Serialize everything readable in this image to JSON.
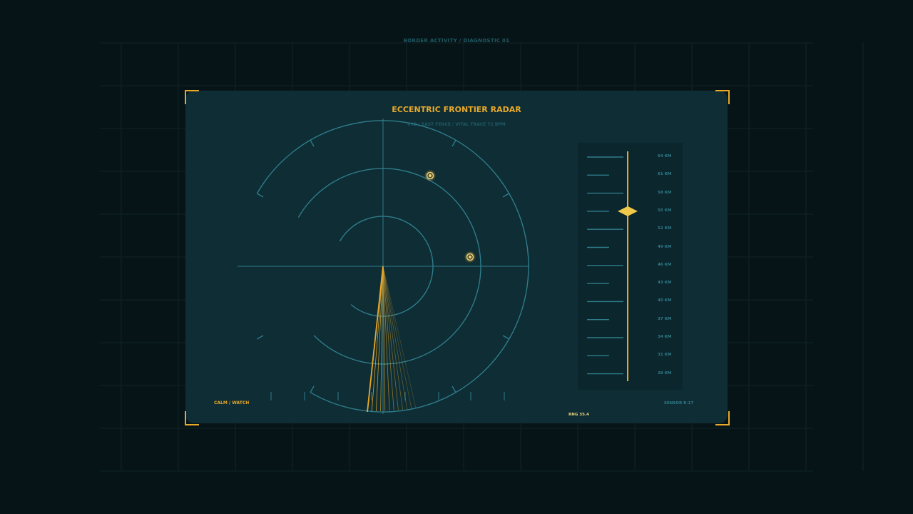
{
  "header": {
    "label": "BORDER ACTIVITY / DIAGNOSTIC 01"
  },
  "radar": {
    "title": "ECCENTRIC FRONTIER RADAR",
    "subtitle": "09D / EAST FENCE / VITAL TRACE 72 BPM",
    "contacts": [
      {
        "name": "contact-1",
        "icon": "target-icon"
      },
      {
        "name": "contact-2",
        "icon": "target-icon"
      }
    ]
  },
  "range_scale": {
    "labels": [
      "64 KM",
      "61 KM",
      "58 KM",
      "55 KM",
      "52 KM",
      "49 KM",
      "46 KM",
      "43 KM",
      "40 KM",
      "37 KM",
      "34 KM",
      "31 KM",
      "28 KM"
    ],
    "selected": "55 KM"
  },
  "status": {
    "mode": "CALM / WATCH",
    "rng": "RNG 35.4",
    "sensor": "SENSOR R-17"
  },
  "colors": {
    "background": "#071417",
    "panel": "#0e2d35",
    "accent": "#e8a92a",
    "line": "#2f7c8a",
    "dim": "#1f5a66"
  }
}
